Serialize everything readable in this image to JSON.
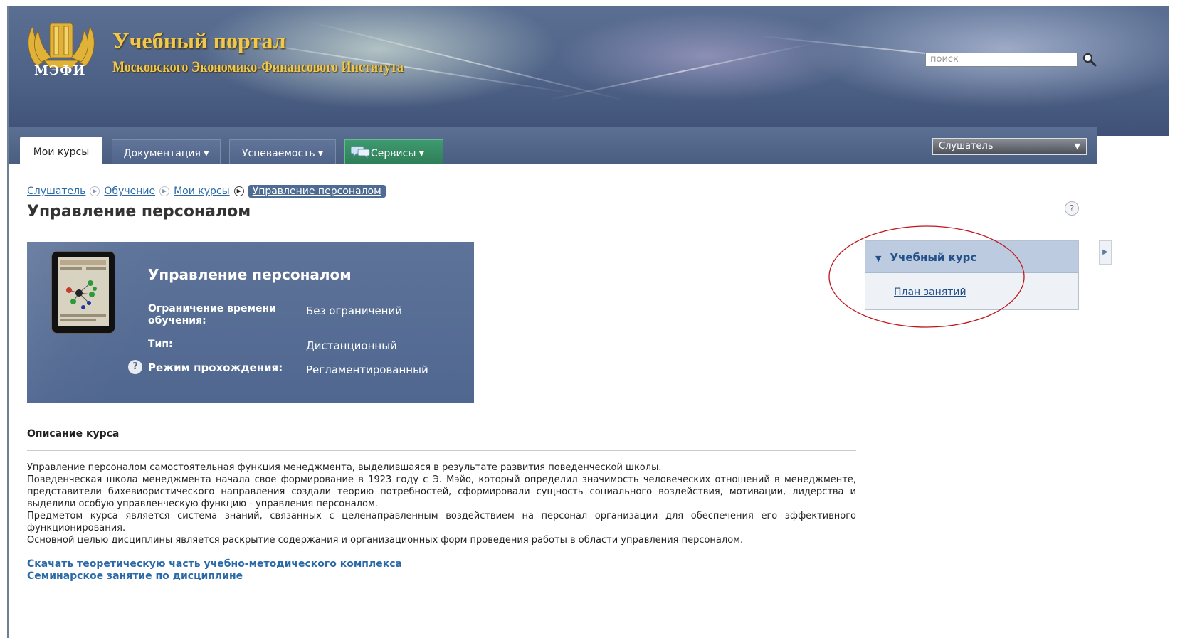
{
  "header": {
    "logo_text": "МЭФИ",
    "title": "Учебный портал",
    "subtitle": "Московского Экономико-Финансового Института",
    "search_placeholder": "поиск"
  },
  "nav": {
    "tabs": [
      {
        "label": "Мои курсы"
      },
      {
        "label": "Документация ▾"
      },
      {
        "label": "Успеваемость ▾"
      },
      {
        "label": "Сервисы ▾"
      }
    ],
    "role_selected": "Слушатель"
  },
  "breadcrumb": {
    "items": [
      "Слушатель",
      "Обучение",
      "Мои курсы"
    ],
    "current": "Управление персоналом"
  },
  "page": {
    "title": "Управление персоналом",
    "help": "?"
  },
  "course_card": {
    "title": "Управление персоналом",
    "rows": [
      {
        "label": "Ограничение времени обучения:",
        "value": "Без ограничений"
      },
      {
        "label": "Тип:",
        "value": "Дистанционный"
      },
      {
        "label": "Режим прохождения:",
        "value": "Регламентированный"
      }
    ],
    "help": "?"
  },
  "widget": {
    "title": "Учебный курс",
    "link": "План занятий"
  },
  "description": {
    "heading": "Описание курса",
    "paragraphs": [
      "Управление персоналом самостоятельная функция менеджмента, выделившаяся в результате развития поведенческой школы.",
      "Поведенческая школа менеджмента начала свое формирование в 1923 году с Э. Мэйо, который определил значимость человеческих отношений в менеджменте, представители бихевиористического направления создали теорию потребностей, сформировали сущность социального воздействия, мотивации, лидерства и выделили особую управленческую функцию - управления персоналом.",
      "Предметом курса является система знаний, связанных с целенаправленным воздействием на персонал организации для обеспечения его эффективного функционирования.",
      "Основной целью дисциплины является раскрытие содержания и организационных форм проведения работы в области управления персоналом."
    ],
    "links": [
      "Скачать теоретическую часть учебно-методического комплекса",
      "Семинарское занятие по дисциплине"
    ]
  },
  "colors": {
    "header_bg": "#4e6287",
    "gold": "#f2c84b",
    "card_bg": "#5a6f96",
    "link": "#2b6aa8",
    "annotation_ellipse": "#c0151b"
  }
}
